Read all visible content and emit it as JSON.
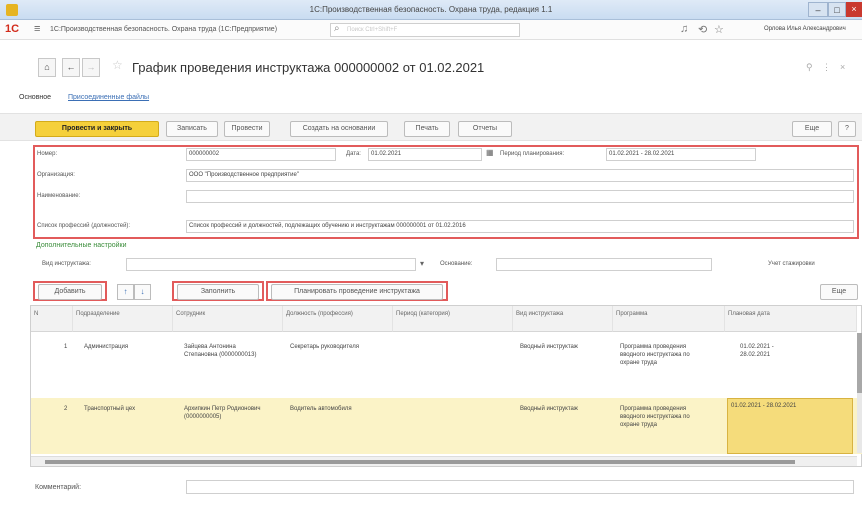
{
  "window": {
    "title": "1С:Производственная безопасность. Охрана труда, редакция 1.1",
    "app_line": "1С:Производственная безопасность. Охрана труда (1С:Предприятие)",
    "search_placeholder": "Поиск Ctrl+Shift+F",
    "user": "Орлова Илья Александрович"
  },
  "document": {
    "title": "График проведения инструктажа 000000002 от 01.02.2021",
    "links": {
      "main": "Основное",
      "files": "Присоединенные файлы"
    }
  },
  "toolbar": {
    "post_close": "Провести и закрыть",
    "save": "Записать",
    "post": "Провести",
    "create_based": "Создать на основании",
    "print": "Печать",
    "reports": "Отчеты",
    "more": "Еще",
    "help": "?"
  },
  "fields": {
    "number_label": "Номер:",
    "number_value": "000000002",
    "date_label": "Дата:",
    "date_value": "01.02.2021",
    "period_label": "Период планирования:",
    "period_value": "01.02.2021 - 28.02.2021",
    "org_label": "Организация:",
    "org_value": "ООО \"Производственное предприятие\"",
    "unit_label": "Наименование:",
    "unit_value": "",
    "list_label": "Список профессий (должностей):",
    "list_value": "Список профессий и должностей, подлежащих обучению и инструктажам 000000001 от 01.02.2016"
  },
  "extra": {
    "section": "Дополнительные настройки",
    "type_label": "Вид инструктажа:",
    "basis_label": "Основание:",
    "account_label": "Учет стажировки"
  },
  "table_toolbar": {
    "add": "Добавить",
    "fill": "Заполнить",
    "plan": "Планировать проведение инструктажа",
    "more": "Еще"
  },
  "table": {
    "columns": [
      "N",
      "Подразделение",
      "Сотрудник",
      "Должность (профессия)",
      "Период (категория)",
      "Вид инструктажа",
      "Программа",
      "Плановая дата"
    ],
    "rows": [
      {
        "n": "1",
        "division": "Администрация",
        "employee": "Зайцева Антонина Степановна (0000000013)",
        "position": "Секретарь руководителя",
        "period": "",
        "type": "Вводный инструктаж",
        "program": "Программа проведения вводного инструктажа по охране труда",
        "date": "01.02.2021 - 28.02.2021"
      },
      {
        "n": "2",
        "division": "Транспортный цех",
        "employee": "Архипкин Петр Родионович (0000000005)",
        "position": "Водитель автомобиля",
        "period": "",
        "type": "Вводный инструктаж",
        "program": "Программа проведения вводного инструктажа по охране труда",
        "date": "01.02.2021 - 28.02.2021"
      }
    ]
  },
  "comment": {
    "label": "Комментарий:"
  },
  "colors": {
    "primary": "#f5d03b",
    "highlight": "#e25b5b",
    "link": "#3b6fb5"
  }
}
